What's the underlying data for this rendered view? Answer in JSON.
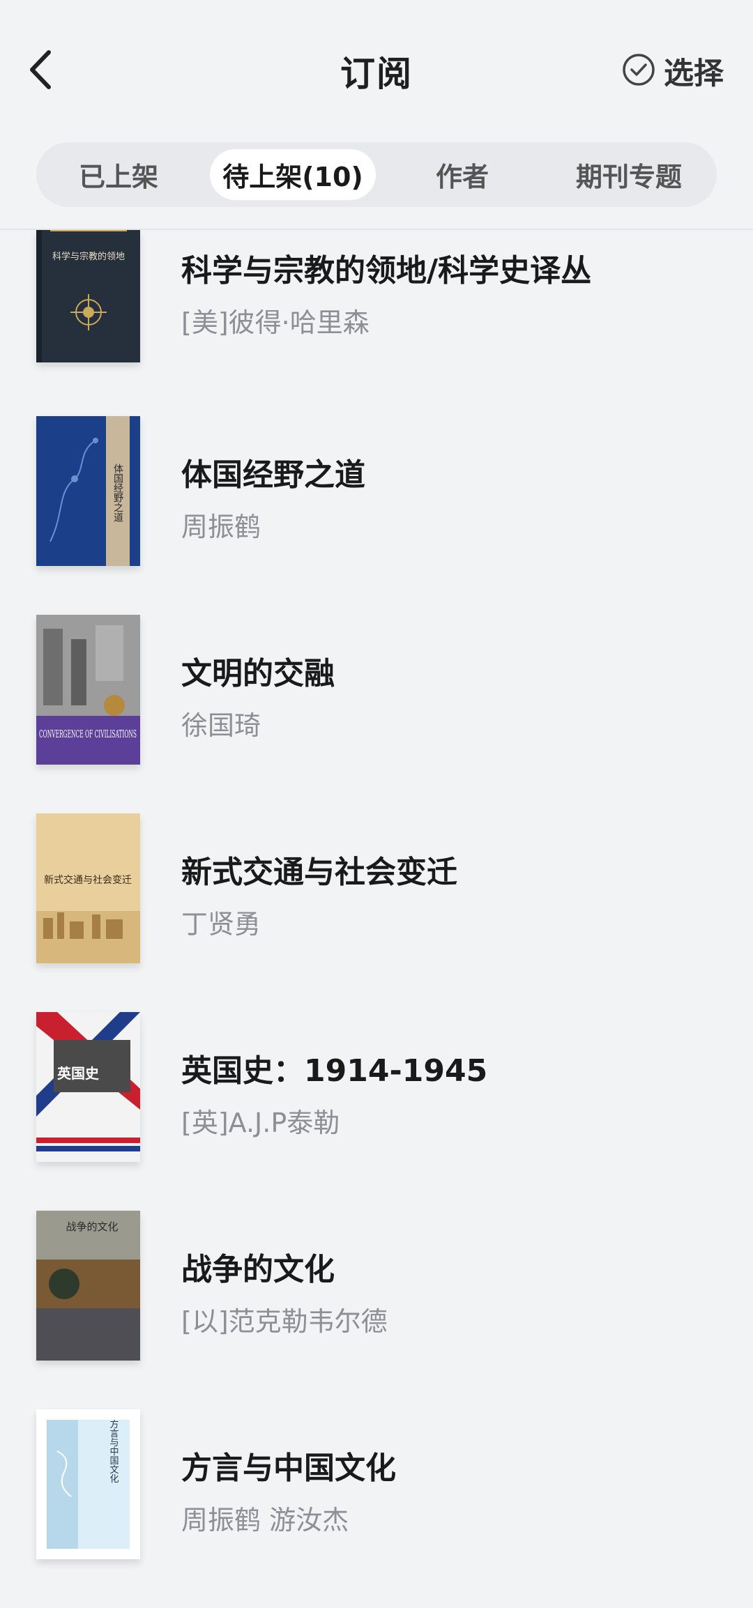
{
  "header": {
    "title": "订阅",
    "select_label": "选择",
    "back_icon": "chevron-left-icon",
    "select_icon": "check-circle-icon"
  },
  "tabs": [
    {
      "label": "已上架",
      "active": false
    },
    {
      "label": "待上架(10)",
      "active": true
    },
    {
      "label": "作者",
      "active": false
    },
    {
      "label": "期刊专题",
      "active": false
    }
  ],
  "books": [
    {
      "title": "科学与宗教的领地/科学史译丛",
      "author": "[美]彼得·哈里森",
      "cover": {
        "bg": "#26303d",
        "accent": "#c9a95a",
        "text": "科学与宗教的领地"
      }
    },
    {
      "title": "体国经野之道",
      "author": "周振鹤",
      "cover": {
        "bg": "#1c3f8a",
        "accent": "#c8b79a",
        "text": "体国经野之道"
      }
    },
    {
      "title": "文明的交融",
      "author": "徐国琦",
      "cover": {
        "bg": "#8a8a8a",
        "accent": "#5b3f99",
        "text": "CONVERGENCE OF CIVILISATIONS"
      }
    },
    {
      "title": "新式交通与社会变迁",
      "author": "丁贤勇",
      "cover": {
        "bg": "#e9cf9b",
        "accent": "#b08a4e",
        "text": "新式交通与社会变迁"
      }
    },
    {
      "title": "英国史：1914-1945",
      "author": "[英]A.J.P泰勒",
      "cover": {
        "bg": "#f3f3f3",
        "accent": "#c8202e",
        "text": "英国史"
      }
    },
    {
      "title": "战争的文化",
      "author": "[以]范克勒韦尔德",
      "cover": {
        "bg": "#6e6e64",
        "accent": "#7a5a35",
        "text": "战争的文化"
      }
    },
    {
      "title": "方言与中国文化",
      "author": "周振鹤 游汝杰",
      "cover": {
        "bg": "#ffffff",
        "accent": "#b7d7ea",
        "text": "方言与中国文化"
      }
    }
  ],
  "colors": {
    "background": "#f2f3f5",
    "title_text": "#1a1a1a",
    "author_text": "#8c8f95",
    "tab_active_bg": "#ffffff",
    "tab_track_bg": "#e8e9ec"
  }
}
